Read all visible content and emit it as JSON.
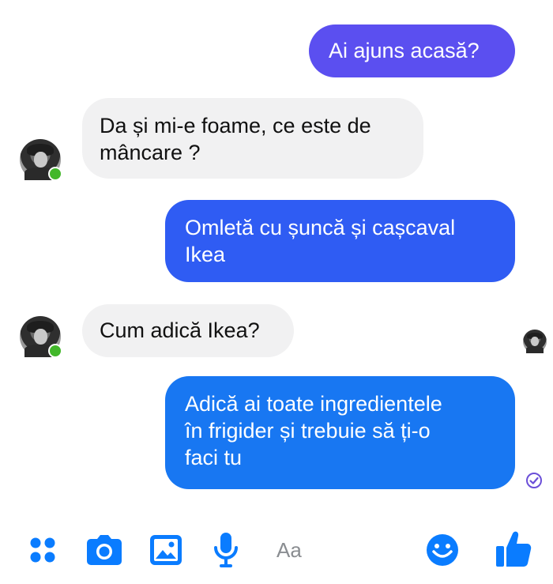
{
  "messages": [
    {
      "direction": "out",
      "text": "Ai ajuns acasă?"
    },
    {
      "direction": "in",
      "text": "Da și mi-e foame, ce este de\nmâncare ?"
    },
    {
      "direction": "out",
      "text": "Omletă cu șuncă și cașcaval\nIkea"
    },
    {
      "direction": "in",
      "text": "Cum adică Ikea?"
    },
    {
      "direction": "out",
      "text": "Adică ai toate ingredientele\nîn frigider și trebuie să ți-o\nfaci tu"
    }
  ],
  "composer": {
    "placeholder": "Aa",
    "icons": [
      "apps-icon",
      "camera-icon",
      "gallery-icon",
      "microphone-icon",
      "emoji-icon",
      "thumbs-up-icon"
    ]
  },
  "status": {
    "delivered": true,
    "seen_avatar": true,
    "contact_online": true
  },
  "colors": {
    "bubble_out_top": "#5b4ff0",
    "bubble_out_mid": "#2f5cf3",
    "bubble_out_bottom": "#1877f2",
    "bubble_in": "#f1f1f2",
    "accent": "#0a7cff",
    "online": "#42b72a",
    "delivered": "#6b4fd8"
  }
}
